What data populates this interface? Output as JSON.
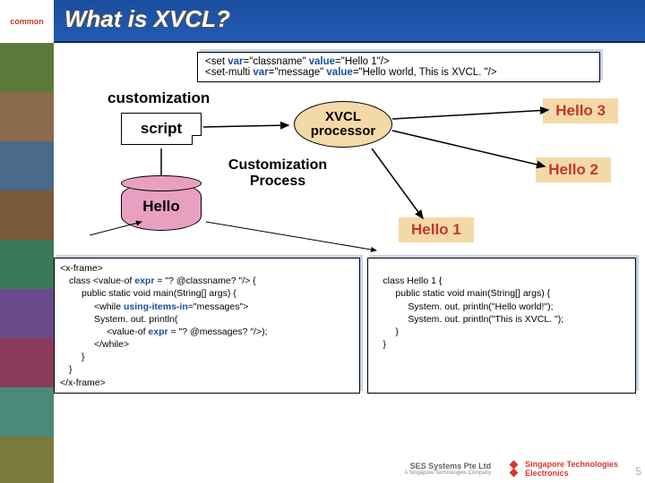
{
  "header": {
    "logo_top": "common",
    "title": "What is XVCL?"
  },
  "top_code": {
    "line1_pre": "<set ",
    "line1_var": "var",
    "line1_eq1": "=\"classname\" ",
    "line1_val": "value",
    "line1_eq2": "=\"Hello 1\"/>",
    "line2_pre": "<set-multi ",
    "line2_var": "var",
    "line2_eq1": "=\"message\" ",
    "line2_val": "value",
    "line2_eq2": "=\"Hello world, This is XVCL. \"/>"
  },
  "labels": {
    "customization": "customization",
    "script": "script",
    "xvcl_processor": "XVCL processor",
    "customization_process": "Customization Process",
    "hello_node": "Hello",
    "hello1": "Hello 1",
    "hello2": "Hello 2",
    "hello3": "Hello 3"
  },
  "left_code": {
    "l1": "<x-frame>",
    "l2a": "class  <value-of ",
    "l2b": "expr",
    "l2c": " = \"? @classname? \"/>  {",
    "l3": "public static void main(String[] args) {",
    "l4a": "<while ",
    "l4b": "using-items-in",
    "l4c": "=\"messages\">",
    "l5": "System. out. println(",
    "l6a": "<value-of ",
    "l6b": "expr",
    "l6c": " = \"? @messages? \"/>);",
    "l7": "</while>",
    "l8": "}",
    "l9": "}",
    "l10": "</x-frame>"
  },
  "right_code": {
    "l1": "class Hello 1  {",
    "l2": "public static void main(String[] args) {",
    "l3": "System. out. println(\"Hello world!\");",
    "l4": "System. out. println(\"This is XVCL. \");",
    "l5": "}",
    "l6": "}"
  },
  "footer": {
    "ses": "SES Systems Pte Ltd",
    "ses_sub": "A Singapore Technologies Company",
    "ste": "Singapore Technologies",
    "ste2": "Electronics",
    "page": "5"
  }
}
